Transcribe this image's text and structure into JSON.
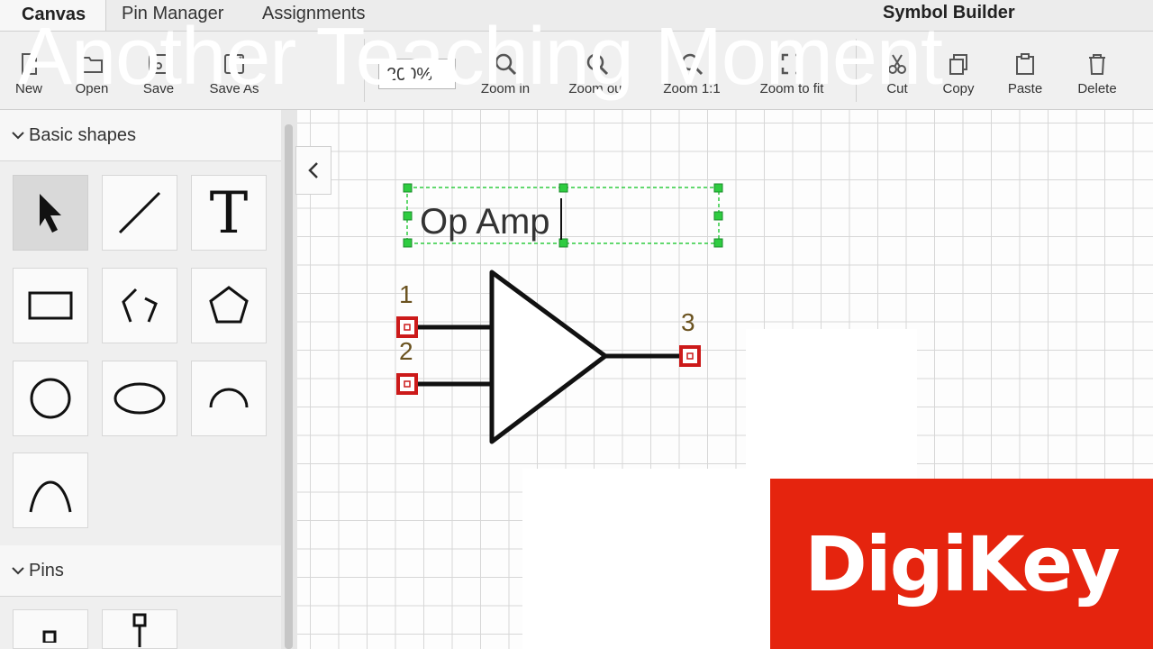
{
  "tabs": [
    {
      "label": "Canvas",
      "active": true
    },
    {
      "label": "Pin Manager",
      "active": false
    },
    {
      "label": "Assignments",
      "active": false
    }
  ],
  "app_title": "Symbol Builder",
  "toolbar": {
    "new_label": "New",
    "open_label": "Open",
    "save_label": "Save",
    "save_as_label": "Save As",
    "zoom_value": "200%",
    "zoom_in_label": "Zoom in",
    "zoom_out_label": "Zoom out",
    "zoom_1_1_label": "Zoom 1:1",
    "zoom_fit_label": "Zoom to fit",
    "cut_label": "Cut",
    "copy_label": "Copy",
    "paste_label": "Paste",
    "delete_label": "Delete"
  },
  "sidebar": {
    "basic_shapes_label": "Basic shapes",
    "pins_label": "Pins",
    "tools": [
      "pointer-icon",
      "line-icon",
      "text-icon",
      "rectangle-icon",
      "polyline-icon",
      "polygon-icon",
      "circle-icon",
      "ellipse-icon",
      "arc-icon",
      "curve-icon"
    ]
  },
  "canvas": {
    "text_label": "Op Amp",
    "pins": [
      "1",
      "2",
      "3"
    ]
  },
  "overlay": {
    "title": "Another Teaching Moment",
    "brand": "DigiKey"
  },
  "colors": {
    "brand": "#e5240e",
    "pin": "#cc1a1a",
    "handle": "#2ecc40"
  }
}
